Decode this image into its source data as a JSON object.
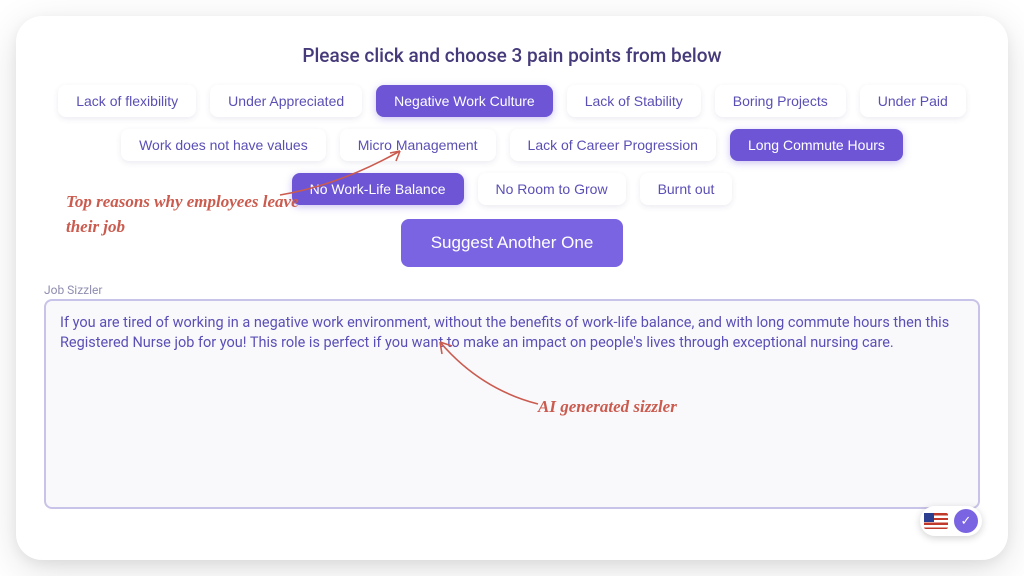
{
  "heading": "Please click and choose 3 pain points from below",
  "chips": [
    {
      "label": "Lack of flexibility",
      "selected": false
    },
    {
      "label": "Under Appreciated",
      "selected": false
    },
    {
      "label": "Negative Work Culture",
      "selected": true
    },
    {
      "label": "Lack of Stability",
      "selected": false
    },
    {
      "label": "Boring Projects",
      "selected": false
    },
    {
      "label": "Under Paid",
      "selected": false
    },
    {
      "label": "Work does not have values",
      "selected": false
    },
    {
      "label": "Micro Management",
      "selected": false
    },
    {
      "label": "Lack of Career Progression",
      "selected": false
    },
    {
      "label": "Long Commute Hours",
      "selected": true
    },
    {
      "label": "No Work-Life Balance",
      "selected": true
    },
    {
      "label": "No Room to Grow",
      "selected": false
    },
    {
      "label": "Burnt out",
      "selected": false
    }
  ],
  "suggest_label": "Suggest Another One",
  "field_label": "Job Sizzler",
  "sizzler_text": "If you are tired of working in a negative work environment, without the benefits of work-life balance, and with long commute hours then this Registered Nurse job for you! This role is perfect if you want to make an impact on people's lives through exceptional nursing care.",
  "annotation1": "Top reasons why employees leave their job",
  "annotation2": "AI generated sizzler",
  "action_glyph": "✓",
  "colors": {
    "accent": "#7a64e2",
    "annotation": "#ca5b4e"
  }
}
